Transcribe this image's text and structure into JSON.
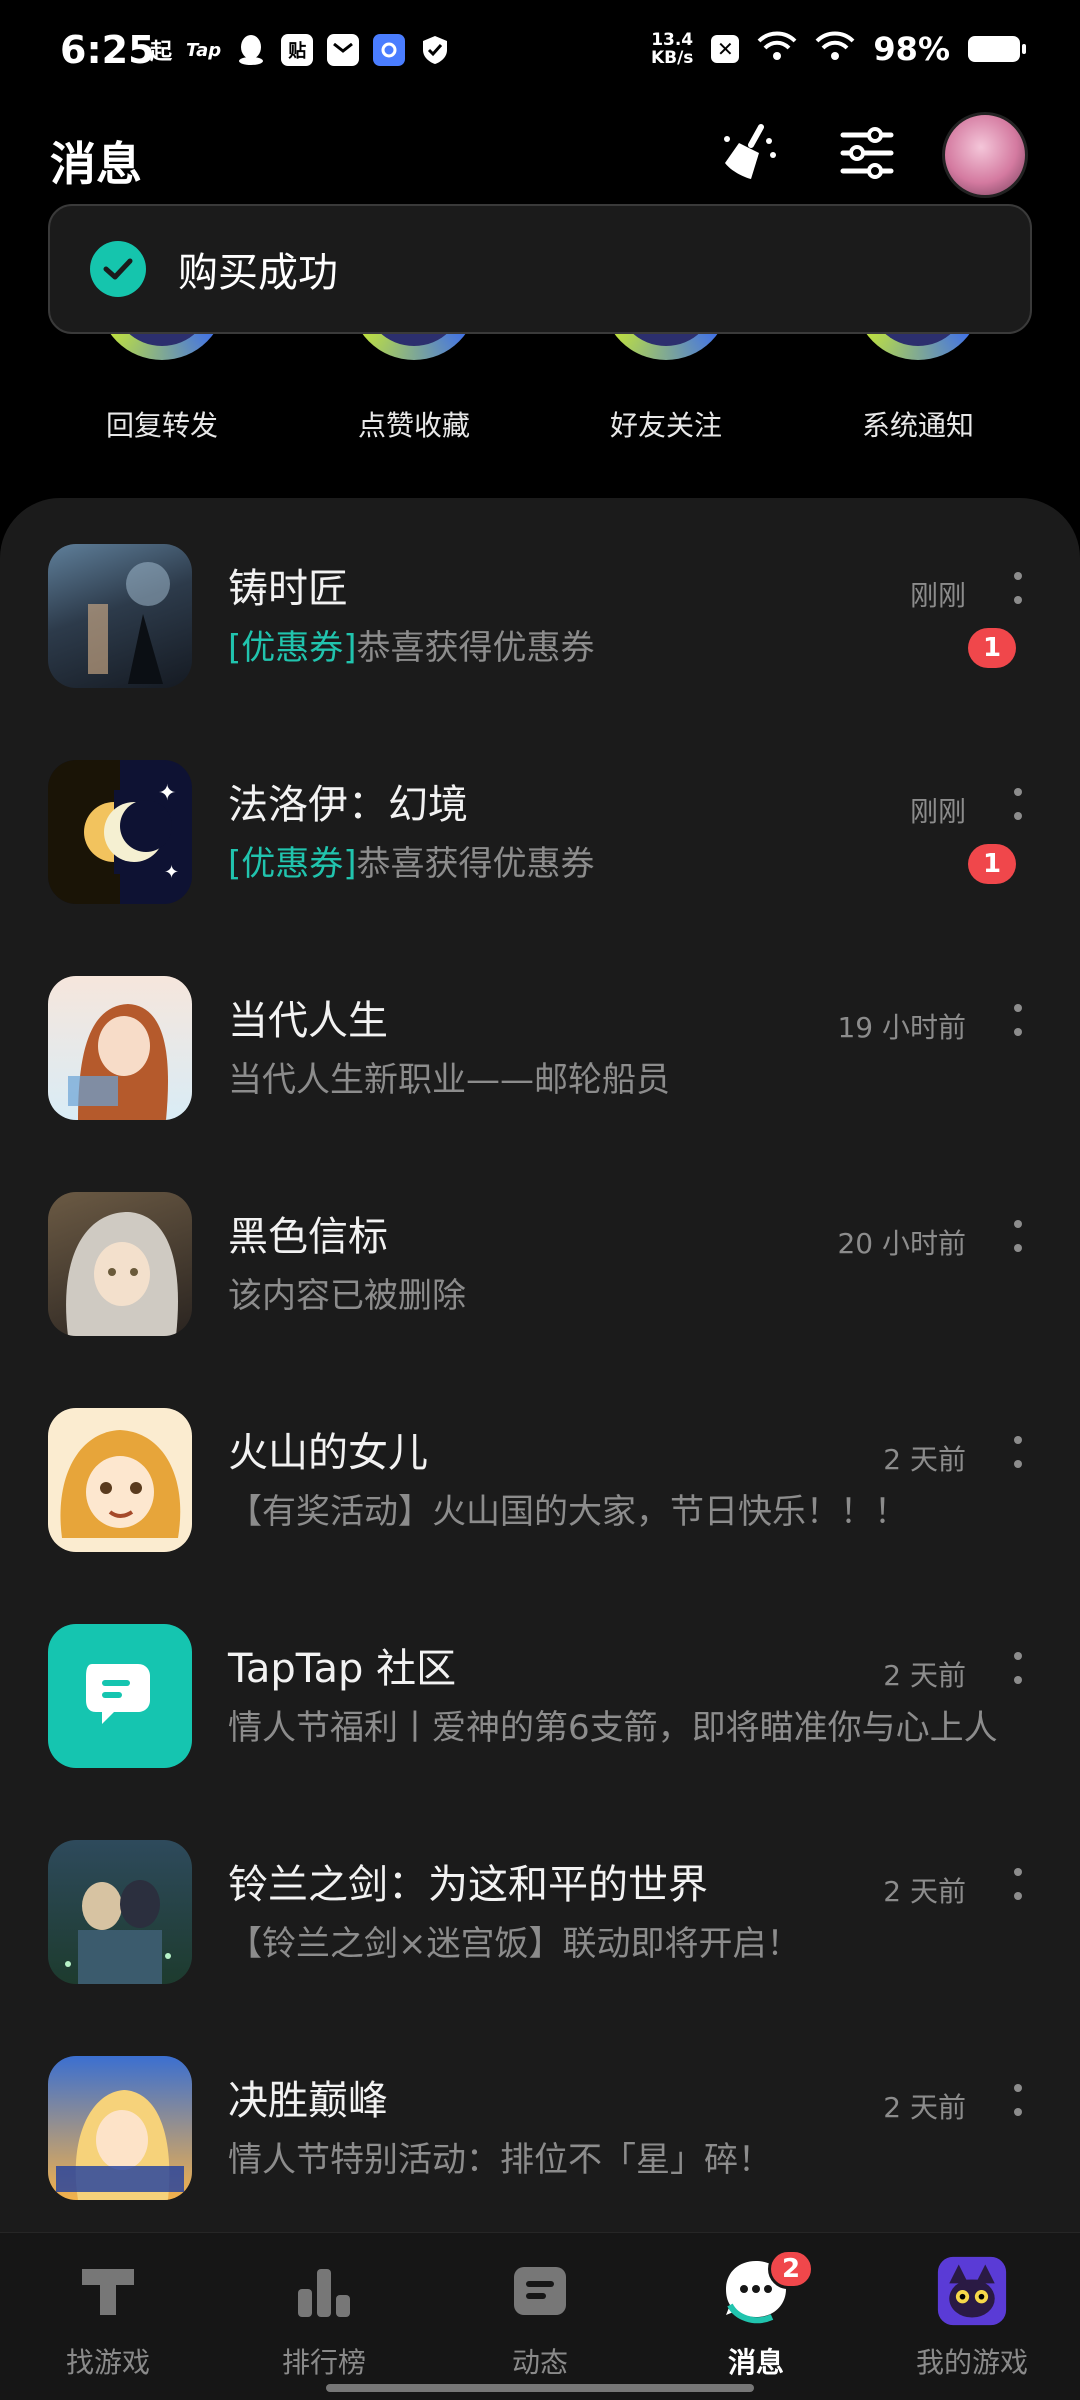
{
  "status_bar": {
    "time": "6:25",
    "left_icons": [
      "起",
      "Tap",
      "qq-icon",
      "贴",
      "mail-icon",
      "browser-icon",
      "shield-icon"
    ],
    "speed_value": "13.4",
    "speed_unit": "KB/s",
    "battery": "98%"
  },
  "header": {
    "title": "消息"
  },
  "toast": {
    "text": "购买成功"
  },
  "categories": [
    {
      "label": "回复转发"
    },
    {
      "label": "点赞收藏"
    },
    {
      "label": "好友关注"
    },
    {
      "label": "系统通知"
    }
  ],
  "messages": [
    {
      "title": "铸时匠",
      "tag": "[优惠券]",
      "text": "恭喜获得优惠券",
      "time": "刚刚",
      "badge": "1"
    },
    {
      "title": "法洛伊：幻境",
      "tag": "[优惠券]",
      "text": "恭喜获得优惠券",
      "time": "刚刚",
      "badge": "1"
    },
    {
      "title": "当代人生",
      "tag": "",
      "text": "当代人生新职业——邮轮船员",
      "time": "19 小时前",
      "badge": ""
    },
    {
      "title": "黑色信标",
      "tag": "",
      "text": "该内容已被删除",
      "time": "20 小时前",
      "badge": ""
    },
    {
      "title": "火山的女儿",
      "tag": "",
      "text": "【有奖活动】火山国的大家，节日快乐！！！",
      "time": "2 天前",
      "badge": ""
    },
    {
      "title": "TapTap 社区",
      "tag": "",
      "text": "情人节福利丨爱神的第6支箭，即将瞄准你与心上人",
      "time": "2 天前",
      "badge": ""
    },
    {
      "title": "铃兰之剑：为这和平的世界",
      "tag": "",
      "text": "【铃兰之剑×迷宫饭】联动即将开启！",
      "time": "2 天前",
      "badge": ""
    },
    {
      "title": "决胜巅峰",
      "tag": "",
      "text": "情人节特别活动：排位不「星」碎！",
      "time": "2 天前",
      "badge": ""
    }
  ],
  "bottom_nav": {
    "items": [
      {
        "label": "找游戏"
      },
      {
        "label": "排行榜"
      },
      {
        "label": "动态"
      },
      {
        "label": "消息",
        "badge": "2"
      },
      {
        "label": "我的游戏"
      }
    ]
  },
  "colors": {
    "accent": "#21c4ae",
    "badge": "#f0474b",
    "panel": "#1b1b1b"
  }
}
